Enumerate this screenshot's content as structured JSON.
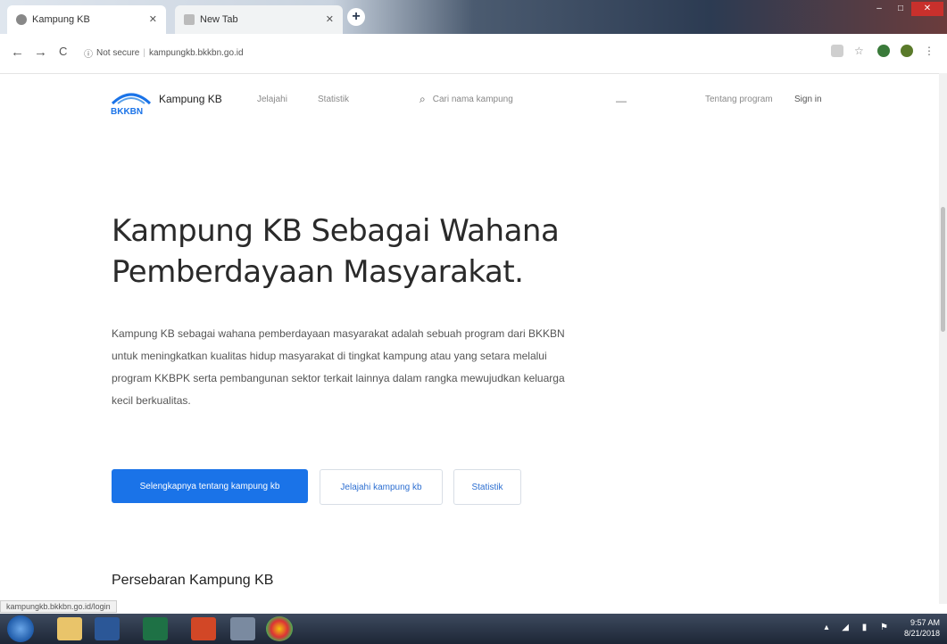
{
  "browser": {
    "tabs": [
      {
        "title": "Kampung KB",
        "active": true
      },
      {
        "title": "New Tab",
        "active": false
      }
    ],
    "new_tab_label": "+",
    "back": "←",
    "forward": "→",
    "reload": "C",
    "security": "Not secure",
    "url": "kampungkb.bkkbn.go.id"
  },
  "header": {
    "brand": "Kampung KB",
    "logo_text": "BKKBN",
    "nav": [
      "Jelajahi",
      "Statistik"
    ],
    "search_placeholder": "Cari nama kampung",
    "search_dash": "—",
    "right_links": [
      "Tentang program",
      "Sign in"
    ]
  },
  "hero": {
    "title": "Kampung KB Sebagai Wahana Pemberdayaan Masyarakat.",
    "description": "Kampung KB sebagai wahana pemberdayaan masyarakat adalah sebuah program dari BKKBN untuk meningkatkan kualitas hidup masyarakat di tingkat kampung atau yang setara melalui program KKBPK serta pembangunan sektor terkait lainnya dalam rangka mewujudkan keluarga kecil berkualitas.",
    "buttons": {
      "primary": "Selengkapnya tentang kampung kb",
      "explore": "Jelajahi kampung kb",
      "stats": "Statistik"
    }
  },
  "section": {
    "title": "Persebaran Kampung KB"
  },
  "status_bar": "kampungkb.bkkbn.go.id/login",
  "taskbar": {
    "time": "9:57 AM",
    "date": "8/21/2018"
  },
  "colors": {
    "primary": "#1a73e8",
    "taskbar": "#1d2636"
  }
}
